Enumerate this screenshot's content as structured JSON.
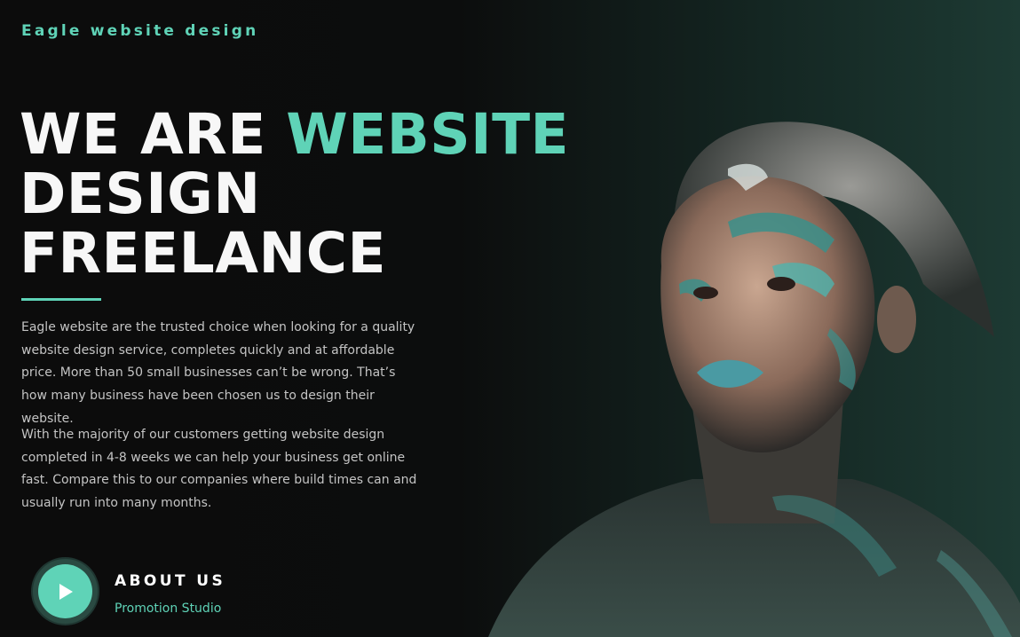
{
  "brand": {
    "name": "Eagle website design"
  },
  "hero": {
    "headline_part1": "WE ARE ",
    "headline_accent": "WEBSITE",
    "headline_line2": "DESIGN",
    "headline_line3": "FREELANCE"
  },
  "intro": {
    "paragraph1": "Eagle website are the trusted choice when looking for a quality website design service, completes quickly and at affordable price. More than 50 small businesses can’t be wrong. That’s how many business have been chosen us to design their website.",
    "paragraph2": "With the majority of our customers getting website design completed in 4-8 weeks we can help your business get online fast. Compare this to our companies where build times can and usually run into many months."
  },
  "about": {
    "title": "ABOUT US",
    "subtitle": "Promotion Studio",
    "play_icon": "play-icon"
  },
  "colors": {
    "accent": "#5fd3b7",
    "background": "#0c0c0c",
    "body_text": "#c4c4c4"
  }
}
